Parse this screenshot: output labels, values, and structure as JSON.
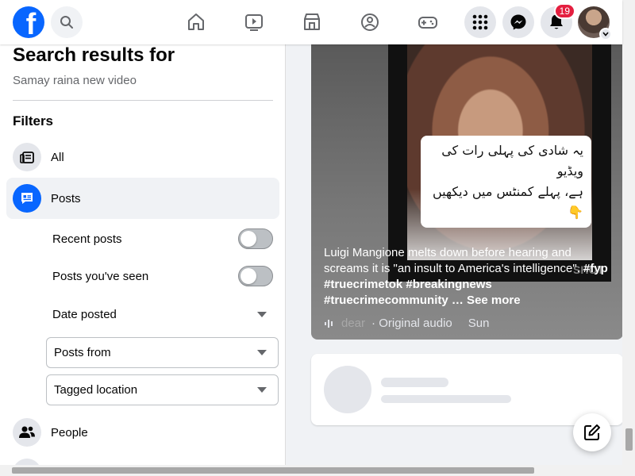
{
  "header": {
    "logo_letter": "f",
    "notifications_badge": "19",
    "nav_icons": [
      "home-icon",
      "video-icon",
      "marketplace-icon",
      "groups-icon",
      "gaming-icon"
    ],
    "right_icons": [
      "menu-grid-icon",
      "messenger-icon",
      "bell-icon"
    ]
  },
  "sidebar": {
    "title": "Search results for",
    "query": "Samay raina new video",
    "filters_heading": "Filters",
    "items": [
      {
        "label": "All",
        "icon": "feed-icon"
      },
      {
        "label": "Posts",
        "icon": "posts-icon",
        "active": true
      },
      {
        "label": "People",
        "icon": "people-icon"
      }
    ],
    "sub_filters": {
      "recent_posts": "Recent posts",
      "posts_seen": "Posts you've seen",
      "date_posted": "Date posted",
      "posts_from": "Posts from",
      "tagged_location": "Tagged location"
    }
  },
  "post": {
    "overlay_text_line1": "یہ شادی کی پہلی رات کی ویڈیو",
    "overlay_text_line2": "ہے، پہلے کمنٹس میں دیکھیں👇",
    "caption": "Luigi Mangione melts down before hearing and screams it is \"an insult to America's intelligence\".",
    "hashtags": "#fyp #truecrimetok #breakingnews #truecrimecommunity",
    "see_more": "… See more",
    "audio_faded": "dear",
    "audio_label": "· Original audio",
    "audio_day": "Sun",
    "watermark": "SHOT"
  },
  "colors": {
    "brand": "#0866ff",
    "badge": "#e41e3f"
  }
}
